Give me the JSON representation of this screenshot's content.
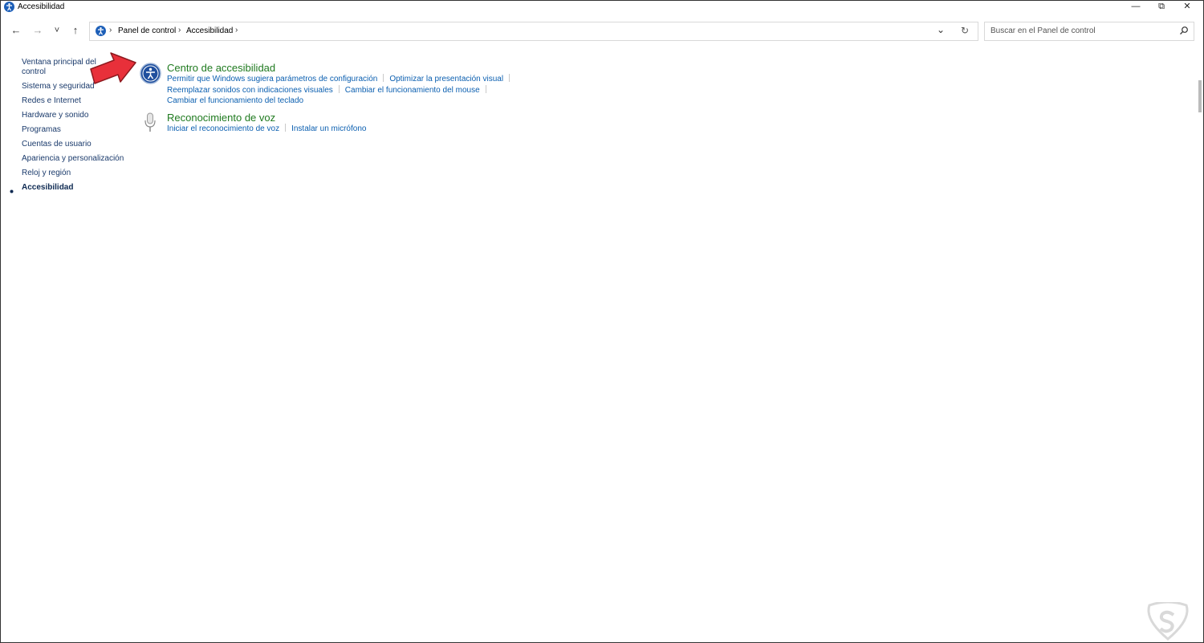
{
  "window": {
    "title": "Accesibilidad",
    "controls": {
      "minimize": "—",
      "maximize": "⧉",
      "close": "✕"
    }
  },
  "nav": {
    "back": "←",
    "forward": "→",
    "recent": "˅",
    "up": "↑",
    "breadcrumb": [
      "Panel de control",
      "Accesibilidad"
    ],
    "separator": "›",
    "dropdown": "⌄",
    "refresh": "↻",
    "search_placeholder": "Buscar en el Panel de control"
  },
  "sidebar": {
    "items": [
      {
        "label": "Ventana principal del control"
      },
      {
        "label": "Sistema y seguridad"
      },
      {
        "label": "Redes e Internet"
      },
      {
        "label": "Hardware y sonido"
      },
      {
        "label": "Programas"
      },
      {
        "label": "Cuentas de usuario"
      },
      {
        "label": "Apariencia y personalización"
      },
      {
        "label": "Reloj y región"
      },
      {
        "label": "Accesibilidad",
        "active": true
      }
    ]
  },
  "sections": [
    {
      "title": "Centro de accesibilidad",
      "icon": "accessibility-center-icon",
      "links": [
        "Permitir que Windows sugiera parámetros de configuración",
        "Optimizar la presentación visual",
        "Reemplazar sonidos con indicaciones visuales",
        "Cambiar el funcionamiento del mouse",
        "Cambiar el funcionamiento del teclado"
      ]
    },
    {
      "title": "Reconocimiento de voz",
      "icon": "microphone-icon",
      "links": [
        "Iniciar el reconocimiento de voz",
        "Instalar un micrófono"
      ]
    }
  ],
  "annotation": {
    "arrow_color": "#e8303a"
  },
  "colors": {
    "section_title": "#1f7a1f",
    "link": "#0b5fb0",
    "sidebar": "#1a3a6b"
  }
}
